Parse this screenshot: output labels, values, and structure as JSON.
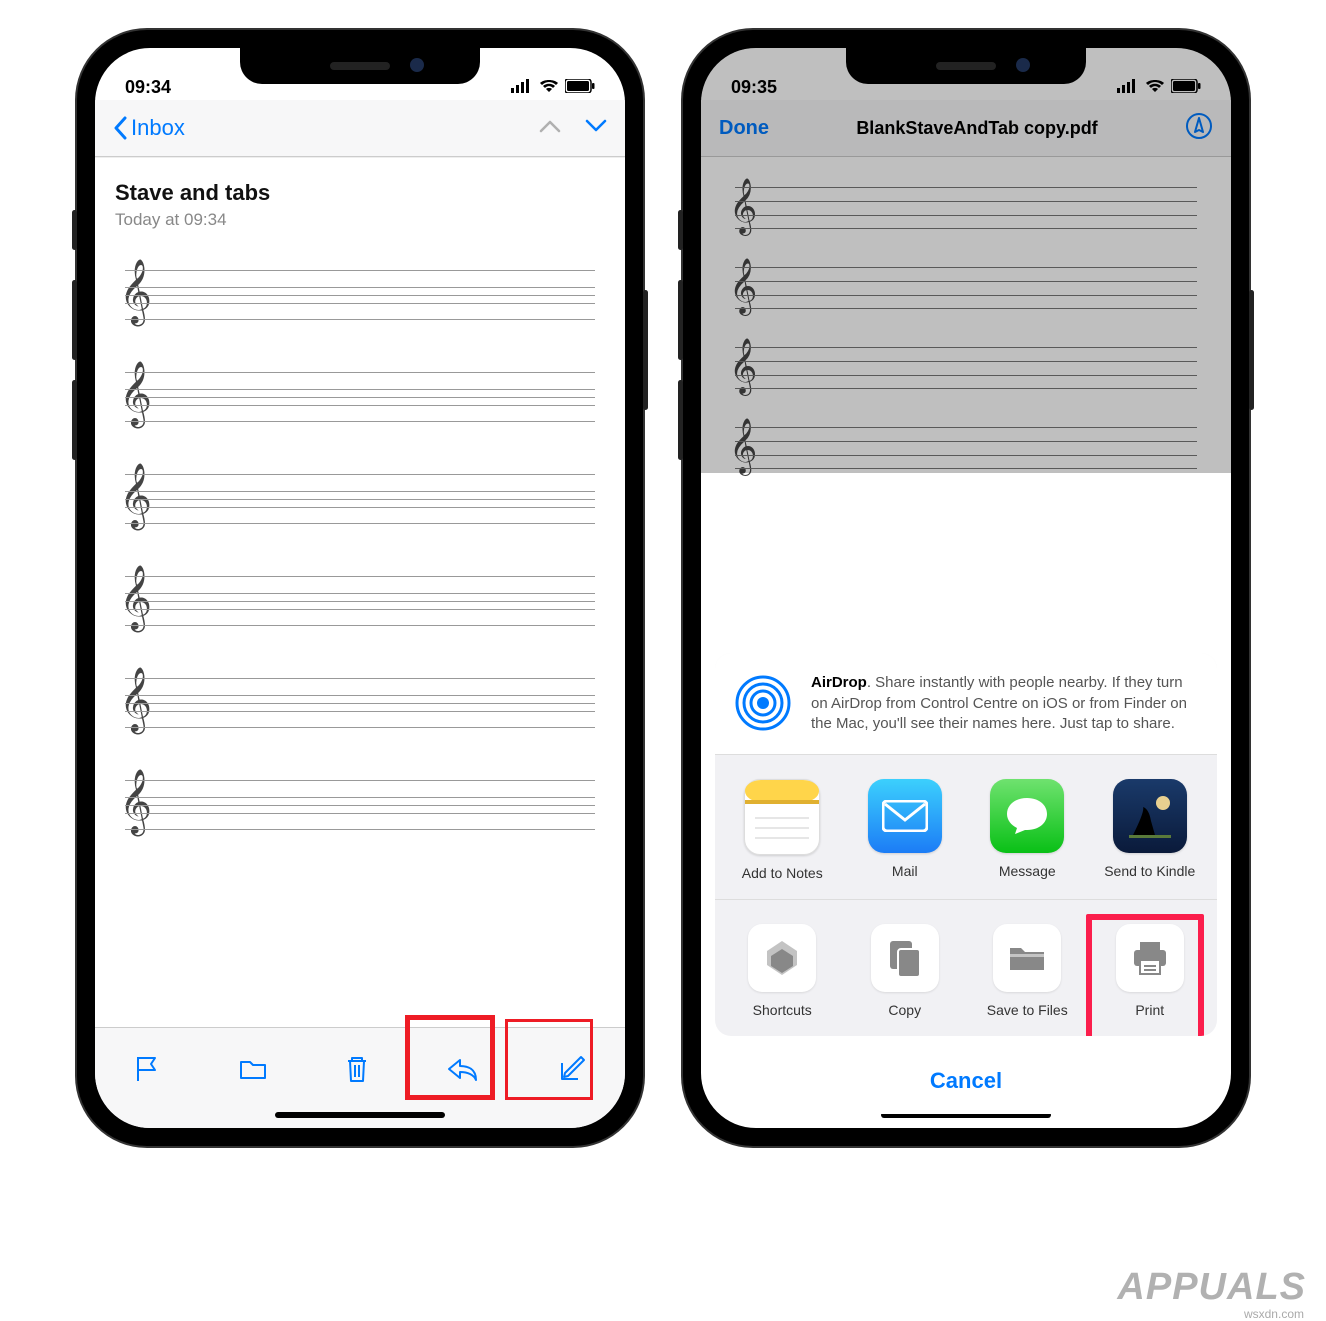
{
  "phone1": {
    "status": {
      "time": "09:34"
    },
    "nav": {
      "back_label": "Inbox"
    },
    "email": {
      "title": "Stave and tabs",
      "date": "Today at 09:34"
    }
  },
  "phone2": {
    "status": {
      "time": "09:35"
    },
    "nav": {
      "done": "Done",
      "filename": "BlankStaveAndTab copy.pdf"
    },
    "share": {
      "airdrop_title": "AirDrop",
      "airdrop_text": ". Share instantly with people nearby. If they turn on AirDrop from Control Centre on iOS or from Finder on the Mac, you'll see their names here. Just tap to share.",
      "apps": [
        {
          "label": "Add to Notes"
        },
        {
          "label": "Mail"
        },
        {
          "label": "Message"
        },
        {
          "label": "Send to Kindle"
        }
      ],
      "actions": [
        {
          "label": "Shortcuts"
        },
        {
          "label": "Copy"
        },
        {
          "label": "Save to Files"
        },
        {
          "label": "Print"
        }
      ],
      "cancel": "Cancel"
    }
  },
  "watermark": {
    "brand": "APPUALS",
    "site": "wsxdn.com"
  }
}
